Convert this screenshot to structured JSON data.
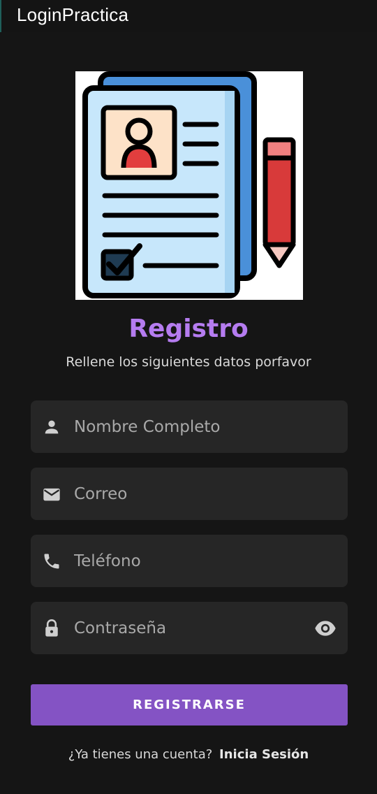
{
  "app": {
    "title": "LoginPractica"
  },
  "header": {
    "title": "Registro",
    "subtitle": "Rellene los siguientes datos porfavor"
  },
  "form": {
    "name": {
      "placeholder": "Nombre Completo",
      "value": "",
      "icon": "person-icon"
    },
    "email": {
      "placeholder": "Correo",
      "value": "",
      "icon": "mail-icon"
    },
    "phone": {
      "placeholder": "Teléfono",
      "value": "",
      "icon": "phone-icon"
    },
    "password": {
      "placeholder": "Contraseña",
      "value": "",
      "icon": "lock-icon",
      "toggle_icon": "eye-icon"
    },
    "submit_label": "REGISTRARSE"
  },
  "footer": {
    "prompt": "¿Ya tienes una cuenta?",
    "link_label": "Inicia Sesión"
  },
  "colors": {
    "background": "#151515",
    "field_background": "#262626",
    "accent": "#b57cf0",
    "button": "#8453c4",
    "text": "#d9d9d9"
  }
}
